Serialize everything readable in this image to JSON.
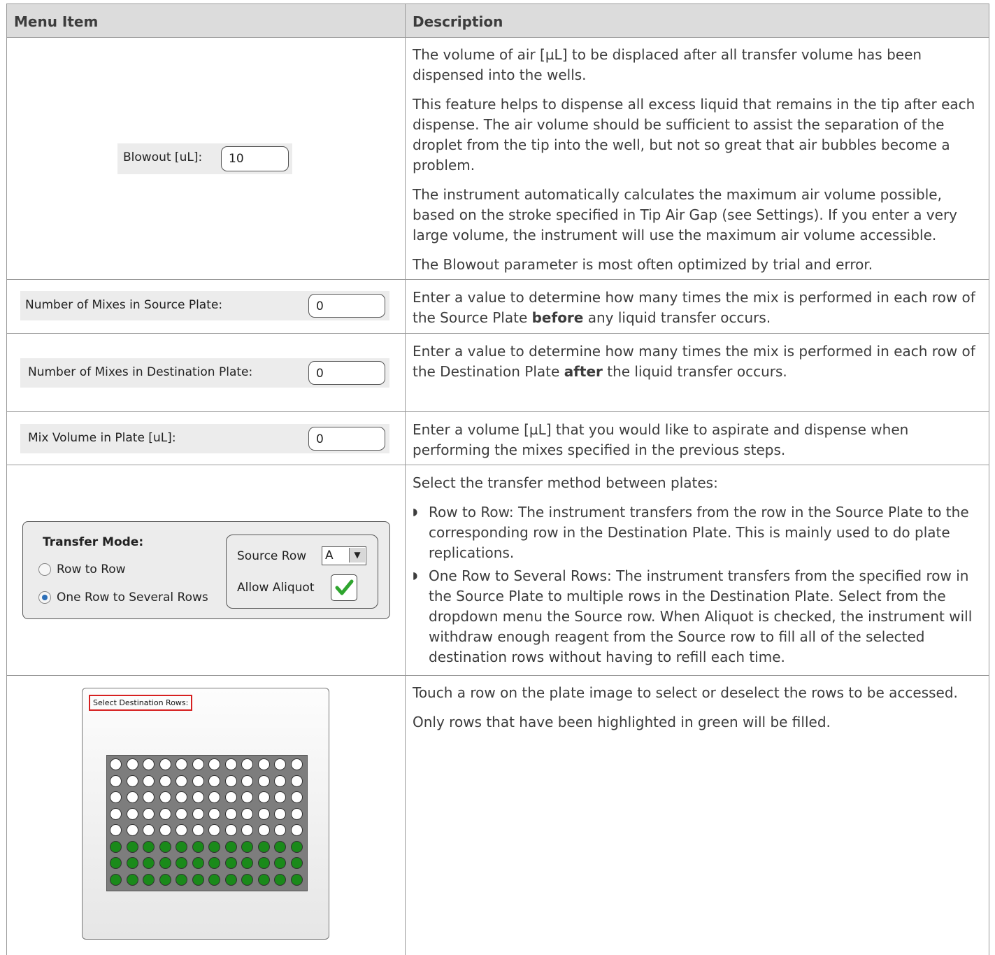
{
  "header": {
    "col1": "Menu Item",
    "col2": "Description"
  },
  "rows": [
    {
      "widget": {
        "label": "Blowout [uL]:",
        "value": "10"
      },
      "paras": [
        "The volume of air [µL] to be displaced after all transfer volume has been dispensed into the wells.",
        "This feature helps to dispense all excess liquid that remains in the tip after each dispense. The air volume should be sufficient to assist the separation of the droplet from the tip into the well, but not so great that air bubbles become a problem.",
        "The instrument automatically calculates the maximum air volume possible, based on the stroke specified in Tip Air Gap (see Settings). If you enter a very large volume, the instrument will use the maximum air volume accessible.",
        "The Blowout parameter is most often optimized by trial and error."
      ]
    },
    {
      "widget": {
        "label": "Number of Mixes in Source Plate:",
        "value": "0"
      },
      "desc_a": "Enter a value to determine how many times the mix is performed in each row of the Source Plate ",
      "desc_bold": "before",
      "desc_b": " any liquid transfer occurs."
    },
    {
      "widget": {
        "label": "Number of Mixes in Destination Plate:",
        "value": "0"
      },
      "desc_a": "Enter a value to determine how many times the mix is performed in each row of the Destination Plate ",
      "desc_bold": "after",
      "desc_b": " the liquid transfer occurs."
    },
    {
      "widget": {
        "label": "Mix Volume in Plate [uL]:",
        "value": "0"
      },
      "desc": "Enter a volume [µL] that you would like to aspirate and dispense when performing the mixes specified in the previous steps."
    },
    {
      "widget": {
        "title": "Transfer Mode:",
        "radio1": "Row to Row",
        "radio2": "One Row to Several Rows",
        "selected": "One Row to Several Rows",
        "source_row_label": "Source Row",
        "source_row_value": "A",
        "aliquot_label": "Allow Aliquot",
        "aliquot_checked": true
      },
      "intro": "Select the transfer method between plates:",
      "bullets": [
        "Row to Row: The instrument transfers from the row in the Source Plate to the corresponding row in the Destination Plate. This is mainly used to do plate replications.",
        "One Row to Several Rows: The instrument transfers from the specified row in the Source Plate to multiple rows in the Destination Plate. Select from the dropdown menu the Source row. When Aliquot is checked, the instrument will withdraw enough reagent from the Source row to fill all of the selected destination rows without having to refill each time."
      ]
    },
    {
      "widget": {
        "title": "Select Destination Rows:",
        "rows": 8,
        "cols": 12,
        "row_states": [
          "empty",
          "empty",
          "empty",
          "empty",
          "empty",
          "selected",
          "selected",
          "selected"
        ],
        "colors": {
          "empty": "#ffffff",
          "selected": "#1a8a1a",
          "highlight": "#d62020"
        }
      },
      "paras": [
        "Touch a row on the plate image to select or deselect the rows to be accessed.",
        "Only rows that have been highlighted in green will be filled."
      ]
    }
  ]
}
